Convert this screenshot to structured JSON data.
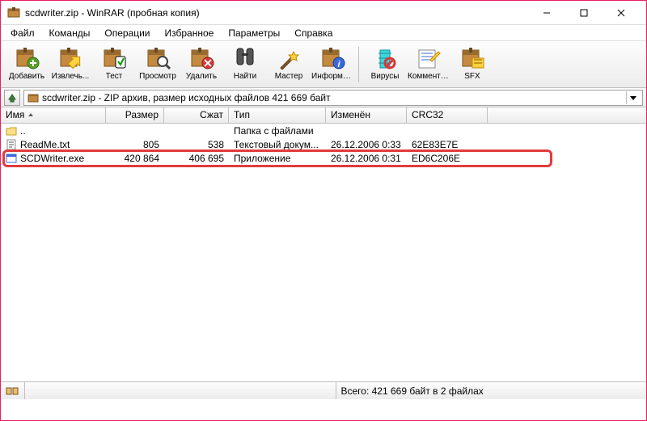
{
  "window": {
    "title": "scdwriter.zip - WinRAR (пробная копия)"
  },
  "menu": [
    "Файл",
    "Команды",
    "Операции",
    "Избранное",
    "Параметры",
    "Справка"
  ],
  "toolbar": [
    {
      "key": "add",
      "label": "Добавить"
    },
    {
      "key": "extract",
      "label": "Извлечь..."
    },
    {
      "key": "test",
      "label": "Тест"
    },
    {
      "key": "view",
      "label": "Просмотр"
    },
    {
      "key": "delete",
      "label": "Удалить"
    },
    {
      "key": "find",
      "label": "Найти"
    },
    {
      "key": "wizard",
      "label": "Мастер"
    },
    {
      "key": "info",
      "label": "Информация"
    },
    {
      "sep": true
    },
    {
      "key": "virus",
      "label": "Вирусы"
    },
    {
      "key": "comment",
      "label": "Комментарий"
    },
    {
      "key": "sfx",
      "label": "SFX"
    }
  ],
  "path": "scdwriter.zip - ZIP архив, размер исходных файлов 421 669 байт",
  "columns": {
    "name": "Имя",
    "size": "Размер",
    "packed": "Сжат",
    "type": "Тип",
    "modified": "Изменён",
    "crc": "CRC32"
  },
  "rows": [
    {
      "icon": "folder-up",
      "name": "..",
      "size": "",
      "packed": "",
      "type": "Папка с файлами",
      "modified": "",
      "crc": ""
    },
    {
      "icon": "txt",
      "name": "ReadMe.txt",
      "size": "805",
      "packed": "538",
      "type": "Текстовый докум...",
      "modified": "26.12.2006 0:33",
      "crc": "62E83E7E"
    },
    {
      "icon": "exe",
      "name": "SCDWriter.exe",
      "size": "420 864",
      "packed": "406 695",
      "type": "Приложение",
      "modified": "26.12.2006 0:31",
      "crc": "ED6C206E"
    }
  ],
  "highlight_row_index": 2,
  "status": {
    "left": "",
    "right": "Всего: 421 669 байт в 2 файлах"
  }
}
